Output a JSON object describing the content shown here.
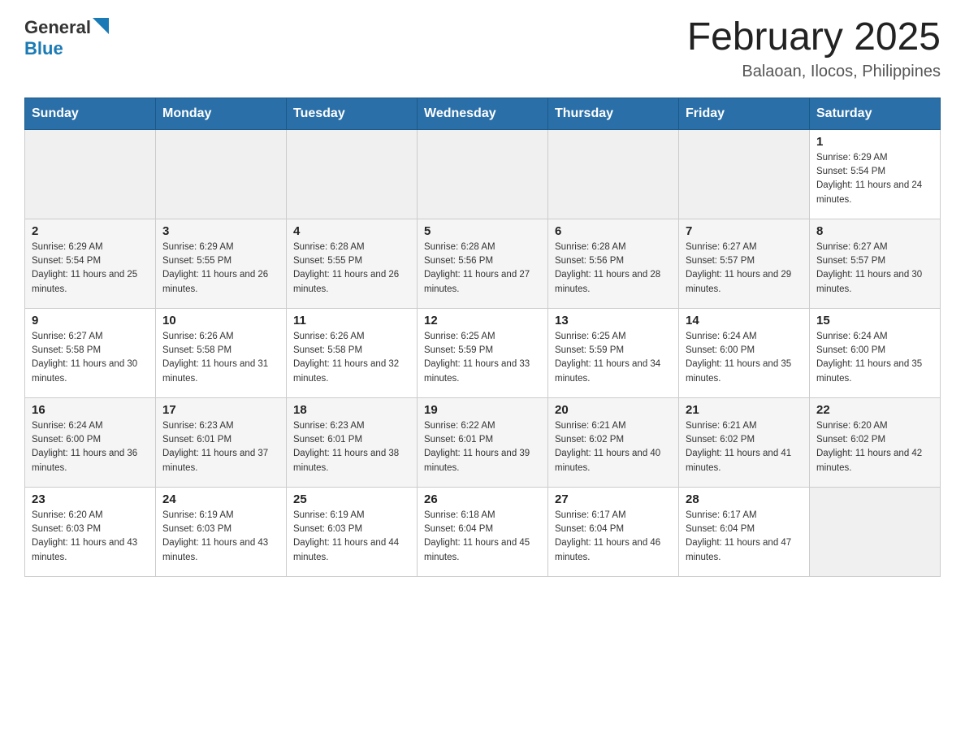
{
  "header": {
    "logo": {
      "general": "General",
      "blue": "Blue"
    },
    "title": "February 2025",
    "location": "Balaoan, Ilocos, Philippines"
  },
  "weekdays": [
    "Sunday",
    "Monday",
    "Tuesday",
    "Wednesday",
    "Thursday",
    "Friday",
    "Saturday"
  ],
  "weeks": [
    {
      "days": [
        {
          "num": "",
          "info": ""
        },
        {
          "num": "",
          "info": ""
        },
        {
          "num": "",
          "info": ""
        },
        {
          "num": "",
          "info": ""
        },
        {
          "num": "",
          "info": ""
        },
        {
          "num": "",
          "info": ""
        },
        {
          "num": "1",
          "info": "Sunrise: 6:29 AM\nSunset: 5:54 PM\nDaylight: 11 hours and 24 minutes."
        }
      ]
    },
    {
      "days": [
        {
          "num": "2",
          "info": "Sunrise: 6:29 AM\nSunset: 5:54 PM\nDaylight: 11 hours and 25 minutes."
        },
        {
          "num": "3",
          "info": "Sunrise: 6:29 AM\nSunset: 5:55 PM\nDaylight: 11 hours and 26 minutes."
        },
        {
          "num": "4",
          "info": "Sunrise: 6:28 AM\nSunset: 5:55 PM\nDaylight: 11 hours and 26 minutes."
        },
        {
          "num": "5",
          "info": "Sunrise: 6:28 AM\nSunset: 5:56 PM\nDaylight: 11 hours and 27 minutes."
        },
        {
          "num": "6",
          "info": "Sunrise: 6:28 AM\nSunset: 5:56 PM\nDaylight: 11 hours and 28 minutes."
        },
        {
          "num": "7",
          "info": "Sunrise: 6:27 AM\nSunset: 5:57 PM\nDaylight: 11 hours and 29 minutes."
        },
        {
          "num": "8",
          "info": "Sunrise: 6:27 AM\nSunset: 5:57 PM\nDaylight: 11 hours and 30 minutes."
        }
      ]
    },
    {
      "days": [
        {
          "num": "9",
          "info": "Sunrise: 6:27 AM\nSunset: 5:58 PM\nDaylight: 11 hours and 30 minutes."
        },
        {
          "num": "10",
          "info": "Sunrise: 6:26 AM\nSunset: 5:58 PM\nDaylight: 11 hours and 31 minutes."
        },
        {
          "num": "11",
          "info": "Sunrise: 6:26 AM\nSunset: 5:58 PM\nDaylight: 11 hours and 32 minutes."
        },
        {
          "num": "12",
          "info": "Sunrise: 6:25 AM\nSunset: 5:59 PM\nDaylight: 11 hours and 33 minutes."
        },
        {
          "num": "13",
          "info": "Sunrise: 6:25 AM\nSunset: 5:59 PM\nDaylight: 11 hours and 34 minutes."
        },
        {
          "num": "14",
          "info": "Sunrise: 6:24 AM\nSunset: 6:00 PM\nDaylight: 11 hours and 35 minutes."
        },
        {
          "num": "15",
          "info": "Sunrise: 6:24 AM\nSunset: 6:00 PM\nDaylight: 11 hours and 35 minutes."
        }
      ]
    },
    {
      "days": [
        {
          "num": "16",
          "info": "Sunrise: 6:24 AM\nSunset: 6:00 PM\nDaylight: 11 hours and 36 minutes."
        },
        {
          "num": "17",
          "info": "Sunrise: 6:23 AM\nSunset: 6:01 PM\nDaylight: 11 hours and 37 minutes."
        },
        {
          "num": "18",
          "info": "Sunrise: 6:23 AM\nSunset: 6:01 PM\nDaylight: 11 hours and 38 minutes."
        },
        {
          "num": "19",
          "info": "Sunrise: 6:22 AM\nSunset: 6:01 PM\nDaylight: 11 hours and 39 minutes."
        },
        {
          "num": "20",
          "info": "Sunrise: 6:21 AM\nSunset: 6:02 PM\nDaylight: 11 hours and 40 minutes."
        },
        {
          "num": "21",
          "info": "Sunrise: 6:21 AM\nSunset: 6:02 PM\nDaylight: 11 hours and 41 minutes."
        },
        {
          "num": "22",
          "info": "Sunrise: 6:20 AM\nSunset: 6:02 PM\nDaylight: 11 hours and 42 minutes."
        }
      ]
    },
    {
      "days": [
        {
          "num": "23",
          "info": "Sunrise: 6:20 AM\nSunset: 6:03 PM\nDaylight: 11 hours and 43 minutes."
        },
        {
          "num": "24",
          "info": "Sunrise: 6:19 AM\nSunset: 6:03 PM\nDaylight: 11 hours and 43 minutes."
        },
        {
          "num": "25",
          "info": "Sunrise: 6:19 AM\nSunset: 6:03 PM\nDaylight: 11 hours and 44 minutes."
        },
        {
          "num": "26",
          "info": "Sunrise: 6:18 AM\nSunset: 6:04 PM\nDaylight: 11 hours and 45 minutes."
        },
        {
          "num": "27",
          "info": "Sunrise: 6:17 AM\nSunset: 6:04 PM\nDaylight: 11 hours and 46 minutes."
        },
        {
          "num": "28",
          "info": "Sunrise: 6:17 AM\nSunset: 6:04 PM\nDaylight: 11 hours and 47 minutes."
        },
        {
          "num": "",
          "info": ""
        }
      ]
    }
  ]
}
